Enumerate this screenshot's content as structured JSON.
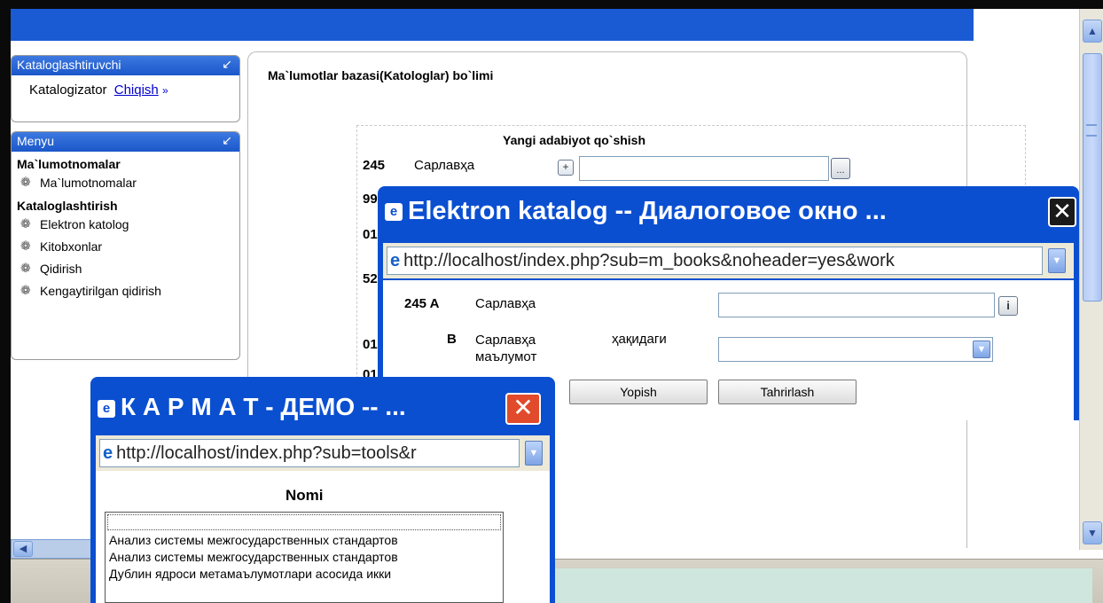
{
  "sidebar": {
    "user_panel": {
      "title": "Kataloglashtiruvchi",
      "user_name": "Katalogizator",
      "logout_label": "Chiqish",
      "logout_suffix": "»"
    },
    "menu_panel": {
      "title": "Menyu",
      "sections": [
        {
          "heading": "Ma`lumotnomalar",
          "items": [
            "Ma`lumotnomalar"
          ]
        },
        {
          "heading": "Kataloglashtirish",
          "items": [
            "Elektron katolog",
            "Kitobxonlar",
            "Qidirish",
            "Kengaytirilgan qidirish"
          ]
        }
      ]
    }
  },
  "content": {
    "title": "Ma`lumotlar bazasi(Katologlar) bo`limi",
    "form": {
      "title": "Yangi adabiyot qo`shish",
      "field_245_code": "245",
      "field_245_label": "Сарлавҳа",
      "partial_codes": [
        "99",
        "01",
        "52",
        "01",
        "01"
      ]
    }
  },
  "popup_katalog": {
    "title": "Elektron katalog -- Диалоговое окно ...",
    "url": "http://localhost/index.php?sub=m_books&noheader=yes&work",
    "rows": [
      {
        "code": "245 A",
        "label": "Сарлавҳа"
      },
      {
        "code": "B",
        "label": "Сарлавҳа маълумот",
        "label_extra": "ҳақидаги"
      }
    ],
    "close_button": "Yopish",
    "edit_button": "Tahrirlash"
  },
  "popup_karmat": {
    "title": "К А Р М А Т - ДЕМО -- ...",
    "url": "http://localhost/index.php?sub=tools&r",
    "column_header": "Nomi",
    "list_items": [
      "Анализ системы межгосударственных стандартов",
      "Анализ системы межгосударственных стандартов",
      "Дублин ядроси метамаълумотлари асосида икки"
    ]
  },
  "icons": {
    "collapse": "collapse-arrow-icon",
    "book": "book-icon",
    "ie": "ie-icon",
    "close": "close-x-icon",
    "dropdown": "chevron-down-icon"
  },
  "colors": {
    "title_bar_blue": "#0b4fd1",
    "panel_header_blue": "#1b57c9",
    "close_red": "#e14a2b",
    "link_blue": "#0000cc"
  }
}
